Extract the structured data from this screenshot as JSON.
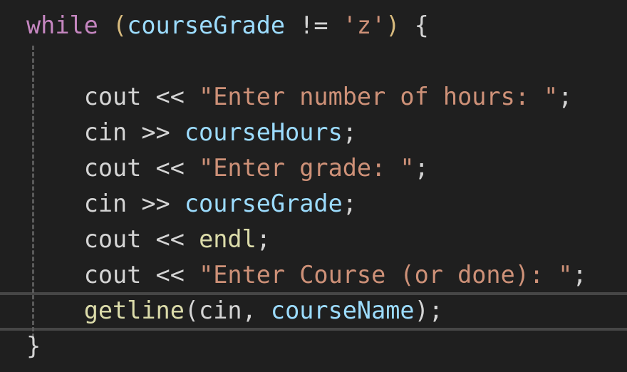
{
  "colors": {
    "background": "#1f1f1f",
    "keyword": "#c586c0",
    "variable": "#9cdcfe",
    "string": "#ce9178",
    "function": "#dcdcaa",
    "plain": "#d4d4d4"
  },
  "lines": [
    {
      "indent": 0,
      "tokens": [
        {
          "t": "while",
          "c": "kw"
        },
        {
          "t": " ",
          "c": "plain"
        },
        {
          "t": "(",
          "c": "paren"
        },
        {
          "t": "courseGrade",
          "c": "var"
        },
        {
          "t": " != ",
          "c": "op"
        },
        {
          "t": "'z'",
          "c": "str"
        },
        {
          "t": ")",
          "c": "paren"
        },
        {
          "t": " {",
          "c": "plain"
        }
      ]
    },
    {
      "indent": 0,
      "tokens": []
    },
    {
      "indent": 1,
      "tokens": [
        {
          "t": "cout",
          "c": "plain"
        },
        {
          "t": " << ",
          "c": "op"
        },
        {
          "t": "\"Enter number of hours: \"",
          "c": "str"
        },
        {
          "t": ";",
          "c": "plain"
        }
      ]
    },
    {
      "indent": 1,
      "tokens": [
        {
          "t": "cin",
          "c": "plain"
        },
        {
          "t": " >> ",
          "c": "op"
        },
        {
          "t": "courseHours",
          "c": "var"
        },
        {
          "t": ";",
          "c": "plain"
        }
      ]
    },
    {
      "indent": 1,
      "tokens": [
        {
          "t": "cout",
          "c": "plain"
        },
        {
          "t": " << ",
          "c": "op"
        },
        {
          "t": "\"Enter grade: \"",
          "c": "str"
        },
        {
          "t": ";",
          "c": "plain"
        }
      ]
    },
    {
      "indent": 1,
      "tokens": [
        {
          "t": "cin",
          "c": "plain"
        },
        {
          "t": " >> ",
          "c": "op"
        },
        {
          "t": "courseGrade",
          "c": "var"
        },
        {
          "t": ";",
          "c": "plain"
        }
      ]
    },
    {
      "indent": 1,
      "tokens": [
        {
          "t": "cout",
          "c": "plain"
        },
        {
          "t": " << ",
          "c": "op"
        },
        {
          "t": "endl",
          "c": "fn"
        },
        {
          "t": ";",
          "c": "plain"
        }
      ]
    },
    {
      "indent": 1,
      "tokens": [
        {
          "t": "cout",
          "c": "plain"
        },
        {
          "t": " << ",
          "c": "op"
        },
        {
          "t": "\"Enter Course (or done): \"",
          "c": "str"
        },
        {
          "t": ";",
          "c": "plain"
        }
      ]
    },
    {
      "indent": 1,
      "tokens": [
        {
          "t": "getline",
          "c": "fn"
        },
        {
          "t": "(",
          "c": "plain"
        },
        {
          "t": "cin",
          "c": "plain"
        },
        {
          "t": ", ",
          "c": "plain"
        },
        {
          "t": "courseName",
          "c": "var"
        },
        {
          "t": ")",
          "c": "plain"
        },
        {
          "t": ";",
          "c": "plain"
        }
      ]
    },
    {
      "indent": 0,
      "tokens": [
        {
          "t": "}",
          "c": "plain"
        }
      ]
    }
  ],
  "current_line": 8
}
